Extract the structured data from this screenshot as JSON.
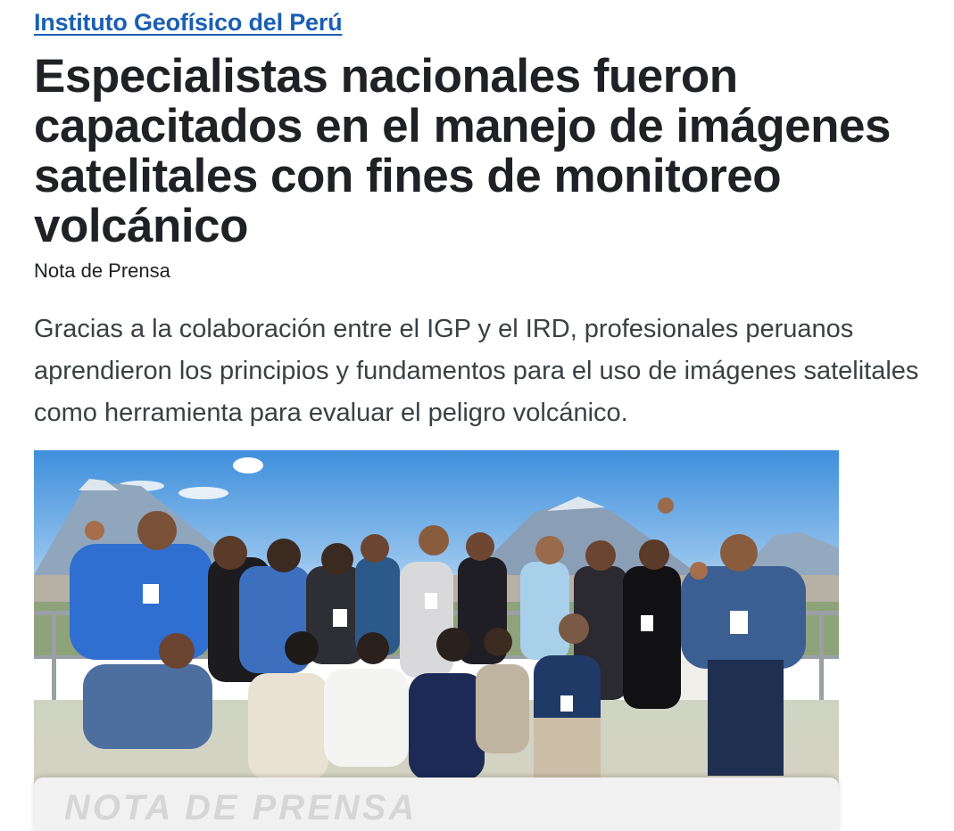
{
  "header": {
    "source_label": "Instituto Geofísico del Perú"
  },
  "article": {
    "title": "Especialistas nacionales fueron capacitados en el manejo de imágenes satelitales con fines de monitoreo volcánico",
    "kind": "Nota de Prensa",
    "summary": "Gracias a la colaboración entre el IGP y el IRD, profesionales peruanos aprendieron los principios y fundamentos para el uso de imágenes satelitales como herramienta para evaluar el peligro volcánico."
  },
  "photo": {
    "caption_label": "NOTA DE PRENSA"
  },
  "colors": {
    "link": "#1a5fb4",
    "text": "#202124",
    "summary_text": "#3c4043",
    "sky_top": "#3f8fdc",
    "sky_bottom": "#9cc8ee"
  }
}
